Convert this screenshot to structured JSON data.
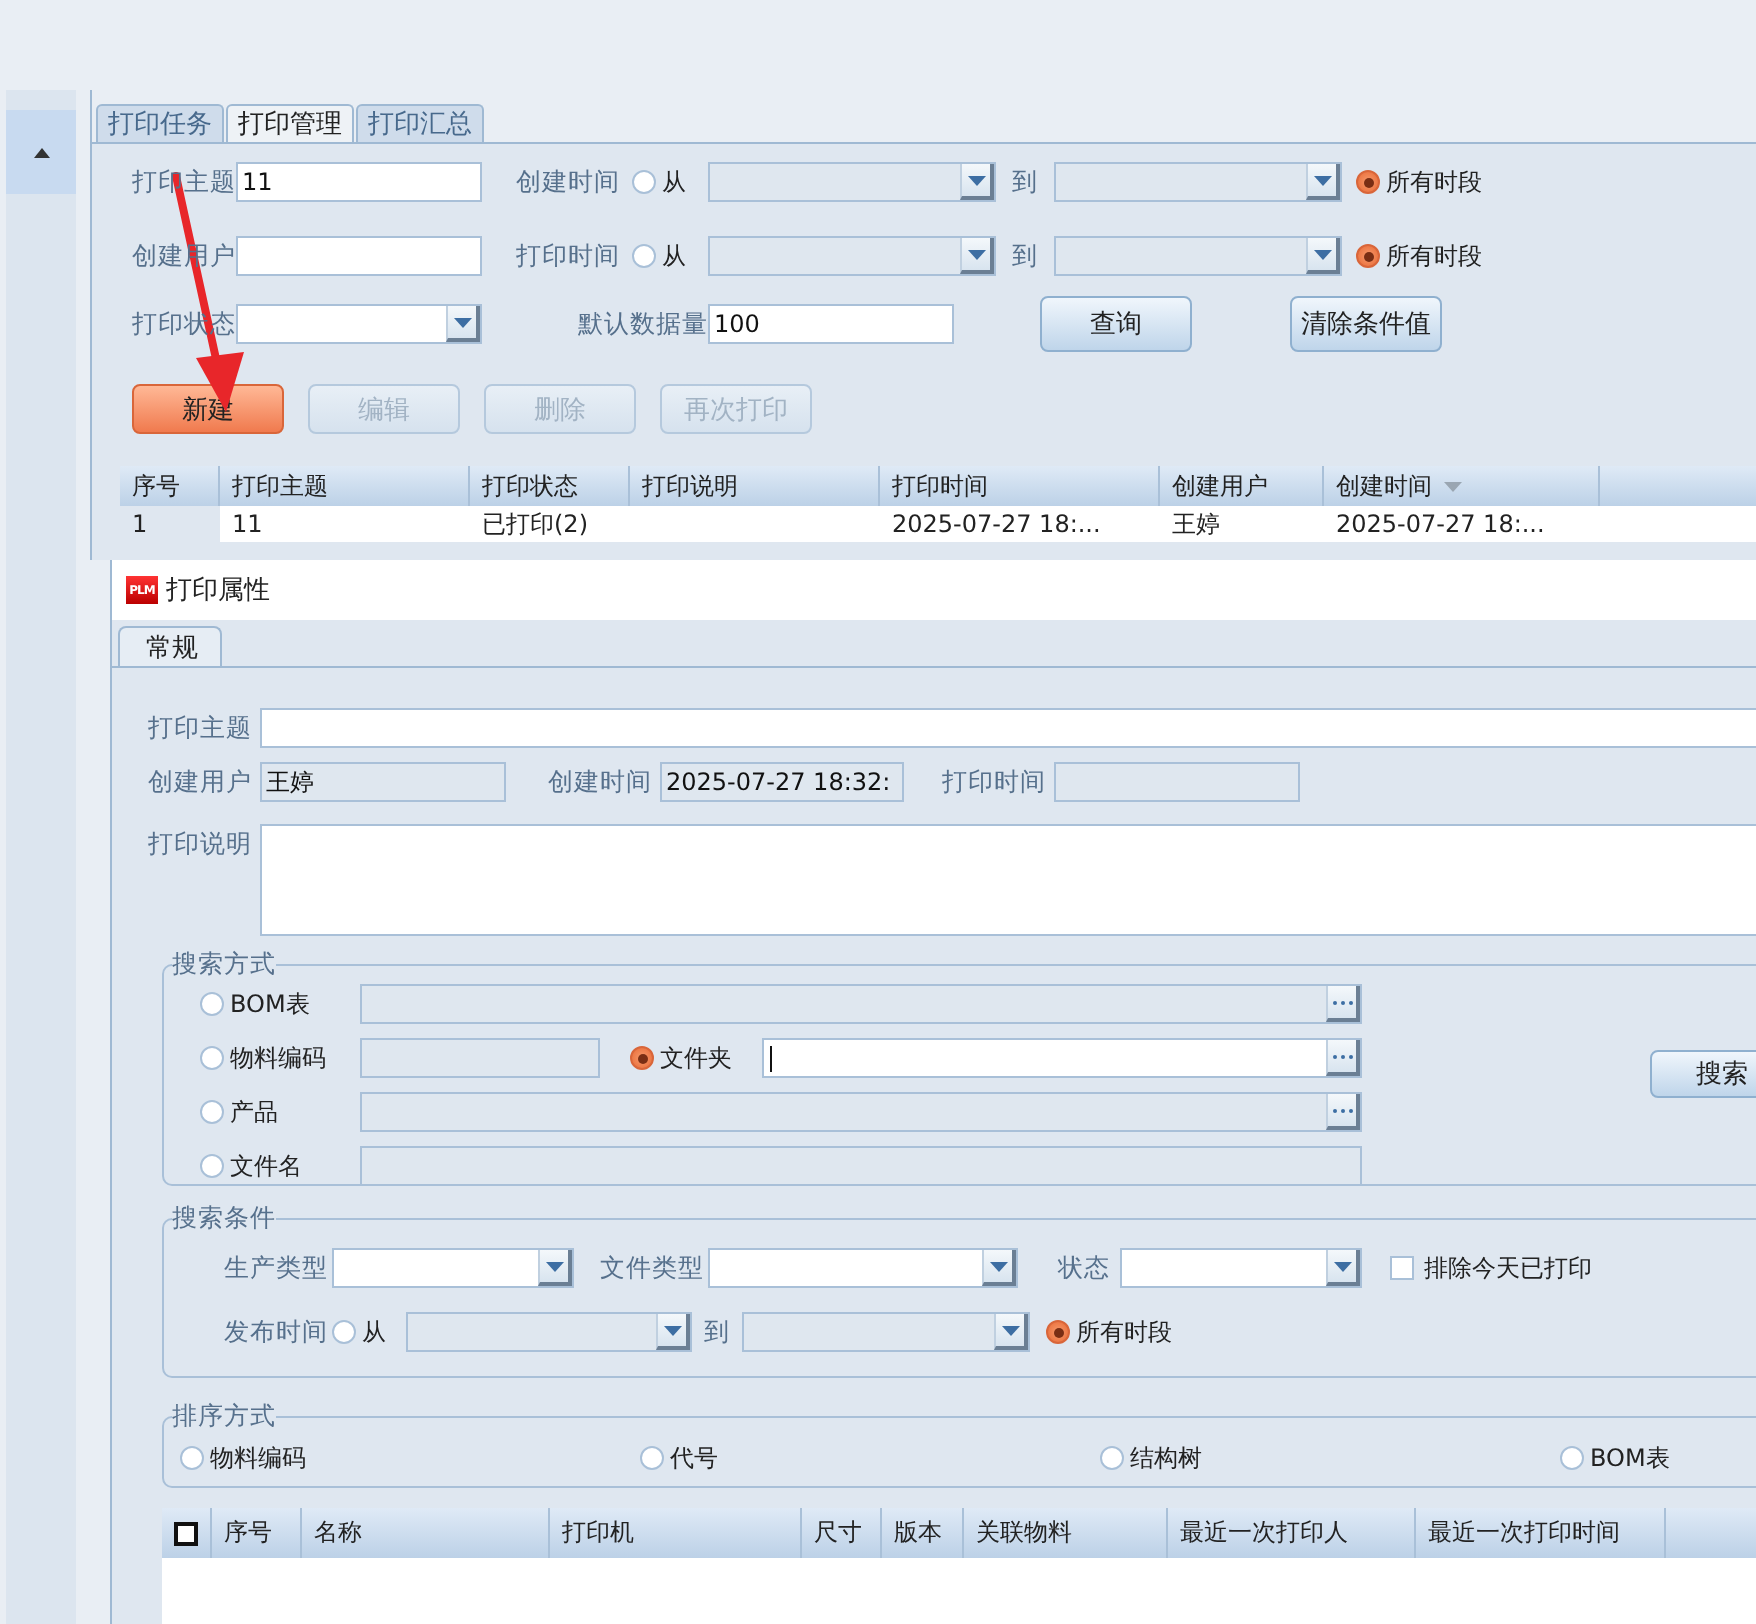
{
  "tabs": [
    {
      "label": "打印任务",
      "selected": false
    },
    {
      "label": "打印管理",
      "selected": true
    },
    {
      "label": "打印汇总",
      "selected": false
    }
  ],
  "filters": [
    [
      {
        "kind": "text",
        "label": "打印主题",
        "value": "11"
      },
      {
        "kind": "range",
        "label": "创建时间",
        "from": "从",
        "to": "到",
        "all": "所有时段",
        "from_selected": false,
        "all_selected": true
      }
    ],
    [
      {
        "kind": "text",
        "label": "创建用户"
      },
      {
        "kind": "range",
        "label": "打印时间",
        "from": "从",
        "to": "到",
        "all": "所有时段",
        "from_selected": false,
        "all_selected": true
      }
    ],
    [
      {
        "kind": "combo",
        "label": "打印状态"
      },
      {
        "kind": "text",
        "label": "默认数据量",
        "value": "100"
      },
      {
        "kind": "button",
        "label": "查询"
      },
      {
        "kind": "button",
        "label": "清除条件值"
      }
    ]
  ],
  "actions": [
    {
      "label": "新建",
      "highlighted": true,
      "disabled": false
    },
    {
      "label": "编辑",
      "highlighted": false,
      "disabled": true
    },
    {
      "label": "删除",
      "highlighted": false,
      "disabled": true
    },
    {
      "label": "再次打印",
      "highlighted": false,
      "disabled": true
    }
  ],
  "table": {
    "columns": [
      {
        "label": "序号",
        "sorted": false
      },
      {
        "label": "打印主题",
        "sorted": false
      },
      {
        "label": "打印状态",
        "sorted": false
      },
      {
        "label": "打印说明",
        "sorted": false
      },
      {
        "label": "打印时间",
        "sorted": false
      },
      {
        "label": "创建用户",
        "sorted": false
      },
      {
        "label": "创建时间",
        "sorted": true
      }
    ],
    "rows": [
      [
        "1",
        "11",
        "已打印(2)",
        null,
        "2025-07-27 18:...",
        "王婷",
        "2025-07-27 18:..."
      ]
    ]
  },
  "dialog": {
    "logo": "PLM",
    "title": "打印属性",
    "tabs": [
      {
        "label": "常规",
        "selected": true
      }
    ],
    "subject": {
      "label": "打印主题"
    },
    "info": [
      {
        "label": "创建用户",
        "value": "王婷"
      },
      {
        "label": "创建时间",
        "value": "2025-07-27 18:32:"
      },
      {
        "label": "打印时间"
      }
    ],
    "description": {
      "label": "打印说明"
    },
    "search_mode": {
      "title": "搜索方式",
      "rows": [
        [
          {
            "label": "BOM表",
            "selected": false,
            "kind": "browse"
          }
        ],
        [
          {
            "label": "物料编码",
            "selected": false,
            "kind": "plain"
          },
          {
            "label": "文件夹",
            "selected": true,
            "kind": "browse"
          }
        ],
        [
          {
            "label": "产品",
            "selected": false,
            "kind": "browse"
          }
        ],
        [
          {
            "label": "文件名",
            "selected": false,
            "kind": "plain"
          }
        ]
      ],
      "button": "搜索"
    },
    "search_conditions": {
      "title": "搜索条件",
      "combos": [
        {
          "label": "生产类型"
        },
        {
          "label": "文件类型"
        },
        {
          "label": "状态"
        }
      ],
      "exclude": {
        "label": "排除今天已打印",
        "checked": false
      },
      "publish": {
        "label": "发布时间",
        "from": "从",
        "to": "到",
        "all": "所有时段",
        "from_selected": false,
        "all_selected": true
      }
    },
    "sort": {
      "title": "排序方式",
      "options": [
        {
          "label": "物料编码",
          "selected": false
        },
        {
          "label": "代号",
          "selected": false
        },
        {
          "label": "结构树",
          "selected": false
        },
        {
          "label": "BOM表",
          "selected": false
        }
      ]
    },
    "table": {
      "select_all": false,
      "columns": [
        "序号",
        "名称",
        "打印机",
        "尺寸",
        "版本",
        "关联物料",
        "最近一次打印人",
        "最近一次打印时间"
      ]
    }
  }
}
